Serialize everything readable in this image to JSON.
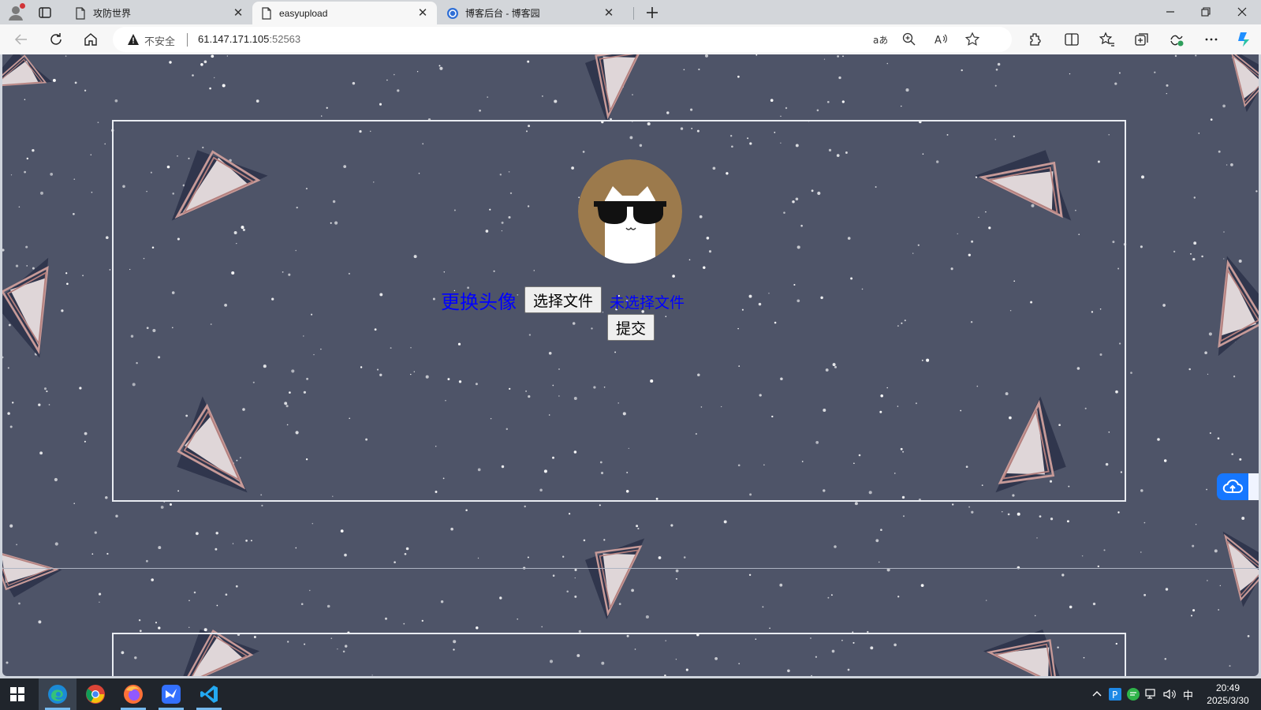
{
  "browser": {
    "tabs": [
      {
        "title": "攻防世界",
        "favicon": "page-icon",
        "active": false
      },
      {
        "title": "easyupload",
        "favicon": "page-icon",
        "active": true
      },
      {
        "title": "博客后台 - 博客园",
        "favicon": "cnblogs-icon",
        "active": false
      }
    ],
    "close_glyph": "✕",
    "address": {
      "security_label": "不安全",
      "host": "61.147.171.105",
      "port": ":52563"
    }
  },
  "page": {
    "avatar_alt": "cool cat with sunglasses",
    "upload_label": "更换头像",
    "choose_file_button": "选择文件",
    "no_file_text": "未选择文件",
    "submit_button": "提交",
    "colors": {
      "background": "#4e5468",
      "frame": "#e9ecf2",
      "link_blue": "#0000ff",
      "avatar_bg": "#9c7a4c"
    }
  },
  "taskbar": {
    "apps": [
      "windows-start-icon",
      "edge-icon",
      "chrome-icon",
      "firefox-icon",
      "feishu-icon",
      "vscode-icon"
    ],
    "ime_label": "中",
    "time": "20:49",
    "date": "2025/3/30"
  }
}
